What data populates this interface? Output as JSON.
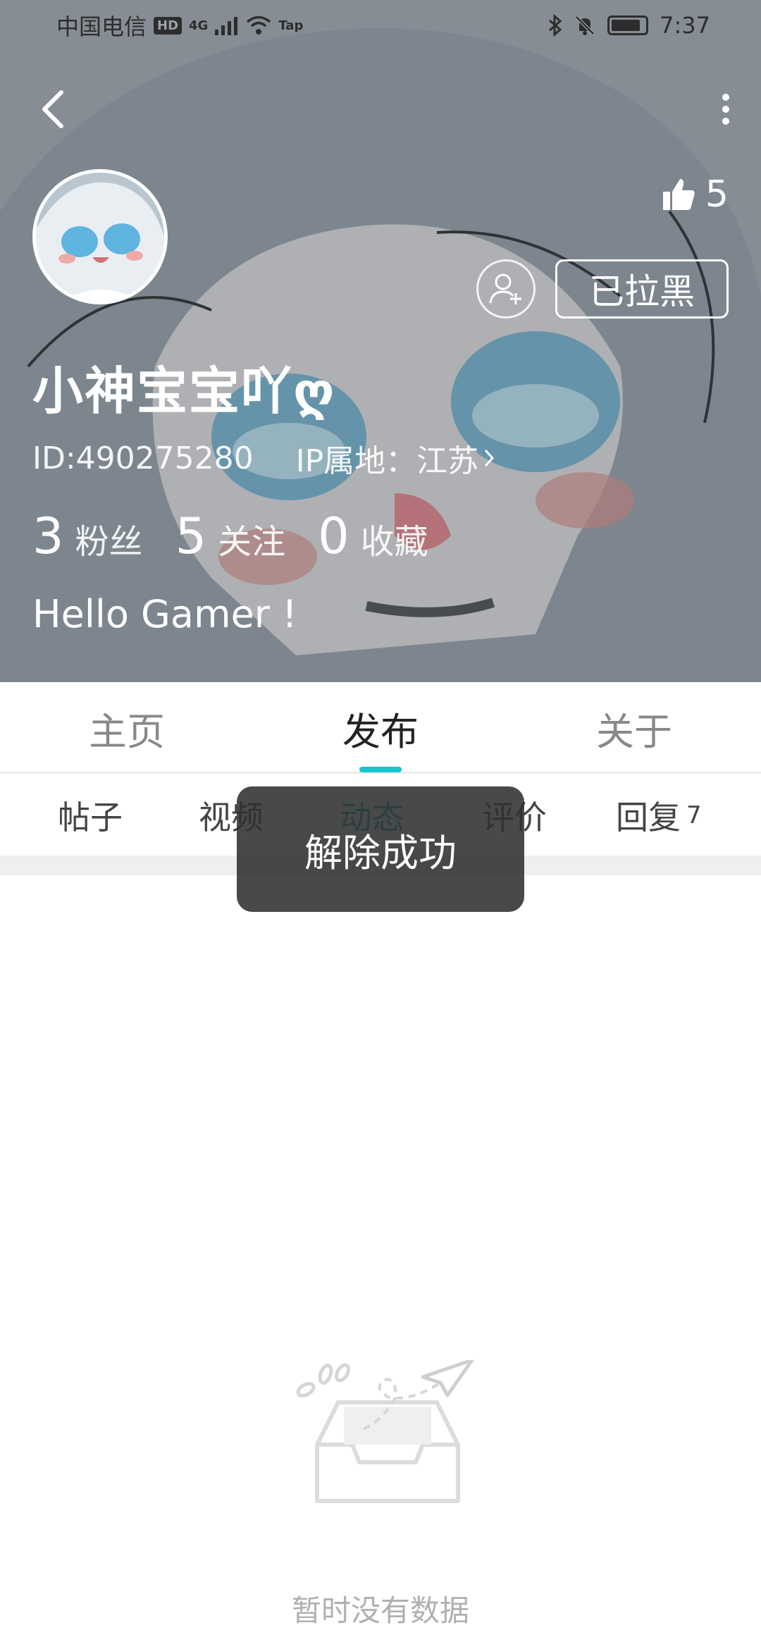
{
  "status_bar": {
    "carrier": "中国电信",
    "hd_badge": "HD",
    "network": "4G",
    "app_badge": "Tap",
    "time": "7:37"
  },
  "profile": {
    "likes_count": "5",
    "blocked_label": "已拉黑",
    "username": "小神宝宝吖ღ",
    "id_text": "ID:490275280",
    "ip_text": "IP属地：江苏",
    "stats": [
      {
        "value": "3",
        "label": "粉丝"
      },
      {
        "value": "5",
        "label": "关注"
      },
      {
        "value": "0",
        "label": "收藏"
      }
    ],
    "bio": "Hello Gamer !"
  },
  "main_tabs": [
    "主页",
    "发布",
    "关于"
  ],
  "active_main_tab": "发布",
  "sub_tabs": [
    {
      "label": "帖子",
      "count": ""
    },
    {
      "label": "视频",
      "count": ""
    },
    {
      "label": "动态",
      "count": ""
    },
    {
      "label": "评价",
      "count": ""
    },
    {
      "label": "回复",
      "count": "7"
    }
  ],
  "active_sub_tab": "动态",
  "toast": "解除成功",
  "empty_state": {
    "text": "暂时没有数据"
  },
  "colors": {
    "accent": "#15c5ce",
    "toast_bg": "#303030"
  },
  "icons": [
    "back-arrow-icon",
    "more-vertical-icon",
    "thumbs-up-icon",
    "add-friend-icon",
    "chevron-right-icon",
    "empty-inbox-icon"
  ]
}
